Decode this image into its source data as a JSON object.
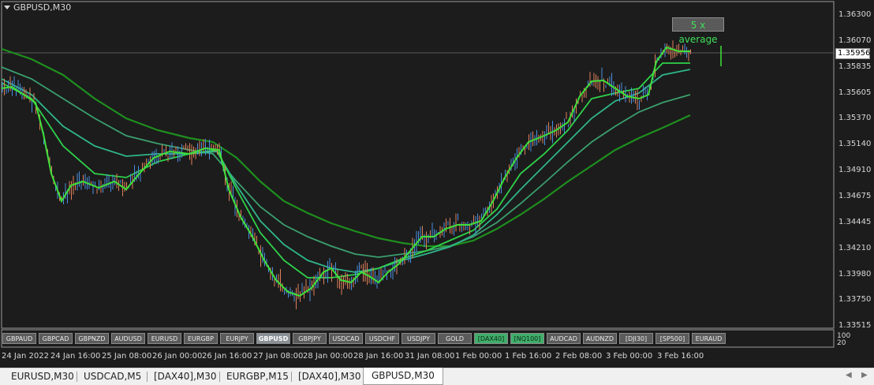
{
  "chart": {
    "title": "GBPUSD,M30",
    "current_price": "1.35956",
    "tooltip": "5 x average",
    "price_labels": [
      "1.36300",
      "1.36070",
      "1.35835",
      "1.35605",
      "1.35370",
      "1.35140",
      "1.34910",
      "1.34675",
      "1.34445",
      "1.34210",
      "1.33980",
      "1.33750",
      "1.33515"
    ],
    "time_labels": [
      "24 Jan 2022",
      "24 Jan 16:00",
      "25 Jan 08:00",
      "26 Jan 00:00",
      "26 Jan 16:00",
      "27 Jan 08:00",
      "28 Jan 00:00",
      "28 Jan 16:00",
      "31 Jan 08:00",
      "1 Feb 00:00",
      "1 Feb 16:00",
      "2 Feb 08:00",
      "3 Feb 00:00",
      "3 Feb 16:00"
    ],
    "indicator_scale": [
      "100",
      "20"
    ],
    "colors": {
      "background": "#1c1c1c",
      "bull": "#4a8fe0",
      "bear": "#e0805a",
      "ma_fast": "#3fe03a",
      "ma_mid": "#2fb58a",
      "ma_slow": "#1e8f1e"
    }
  },
  "symbol_buttons": [
    {
      "label": "GBPAUD",
      "state": "normal"
    },
    {
      "label": "GBPCAD",
      "state": "normal"
    },
    {
      "label": "GBPNZD",
      "state": "normal"
    },
    {
      "label": "AUDUSD",
      "state": "normal"
    },
    {
      "label": "EURUSD",
      "state": "normal"
    },
    {
      "label": "EURGBP",
      "state": "normal"
    },
    {
      "label": "EURJPY",
      "state": "normal"
    },
    {
      "label": "GBPUSD",
      "state": "active"
    },
    {
      "label": "GBPJPY",
      "state": "normal"
    },
    {
      "label": "USDCAD",
      "state": "normal"
    },
    {
      "label": "USDCHF",
      "state": "normal"
    },
    {
      "label": "USDJPY",
      "state": "normal"
    },
    {
      "label": "GOLD",
      "state": "normal"
    },
    {
      "label": "[DAX40]",
      "state": "green"
    },
    {
      "label": "[NQ100]",
      "state": "green"
    },
    {
      "label": "AUDCAD",
      "state": "normal"
    },
    {
      "label": "AUDNZD",
      "state": "normal"
    },
    {
      "label": "[DJI30]",
      "state": "normal"
    },
    {
      "label": "[SP500]",
      "state": "normal"
    },
    {
      "label": "EURAUD",
      "state": "normal"
    }
  ],
  "tabs": [
    {
      "label": "EURUSD,M30",
      "active": false
    },
    {
      "label": "USDCAD,M5",
      "active": false
    },
    {
      "label": "[DAX40],M30",
      "active": false
    },
    {
      "label": "EURGBP,M15",
      "active": false
    },
    {
      "label": "[DAX40],M30",
      "active": false
    },
    {
      "label": "GBPUSD,M30",
      "active": true
    }
  ]
}
